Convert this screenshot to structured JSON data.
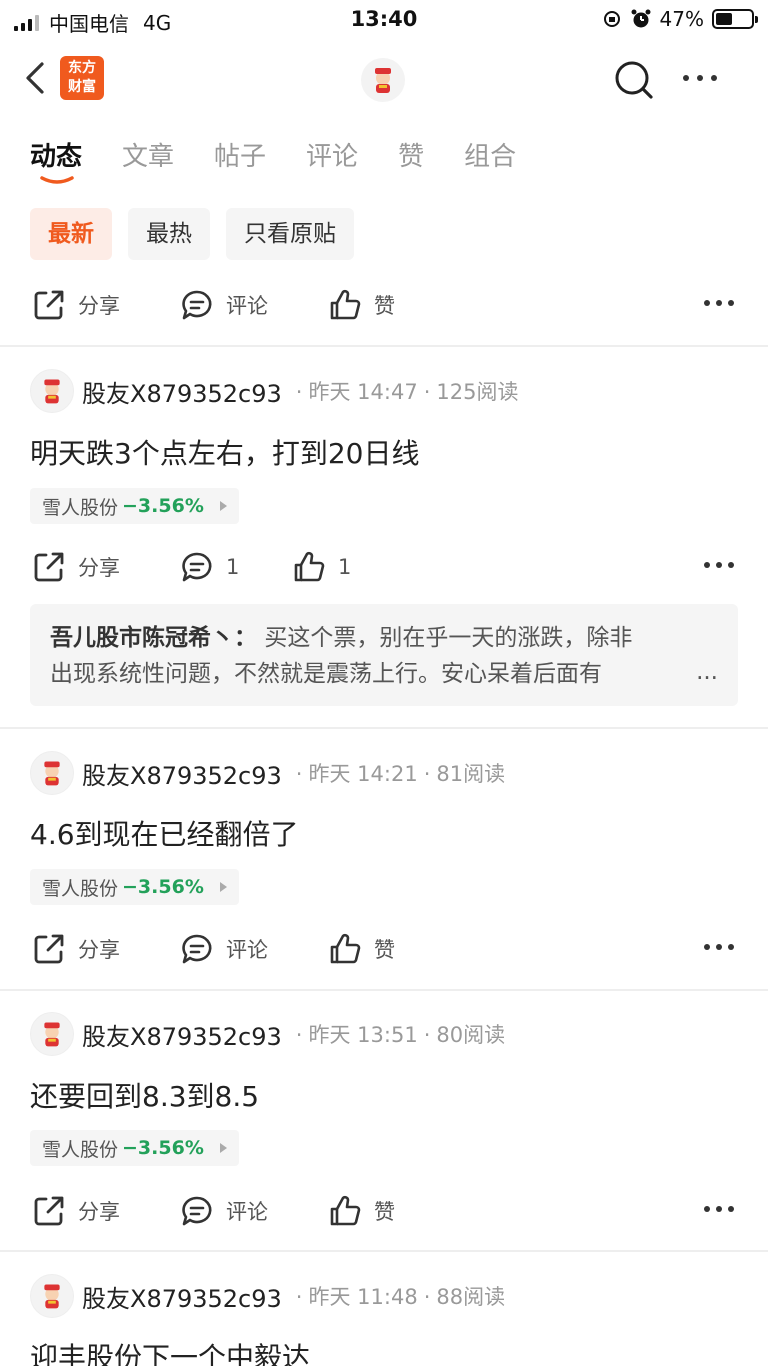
{
  "status_bar": {
    "carrier": "中国电信",
    "network": "4G",
    "time": "13:40",
    "battery": "47%",
    "battery_level": 0.47
  },
  "nav": {
    "logo_line1": "东方",
    "logo_line2": "财富"
  },
  "tabs": [
    {
      "label": "动态",
      "active": true
    },
    {
      "label": "文章"
    },
    {
      "label": "帖子"
    },
    {
      "label": "评论"
    },
    {
      "label": "赞"
    },
    {
      "label": "组合"
    }
  ],
  "filters": [
    "最新",
    "最热",
    "只看原贴"
  ],
  "top_actions": {
    "share": "分享",
    "comment": "评论",
    "like": "赞"
  },
  "posts": [
    {
      "author": "股友X879352c93",
      "time": "昨天 14:47",
      "reads": "125阅读",
      "content": "明天跌3个点左右，打到20日线",
      "stock": "雪人股份",
      "change": "−3.56%",
      "share": "分享",
      "comment": "1",
      "like": "1",
      "reply": {
        "author": "吾儿股市陈冠希丶：",
        "text_line1": "买这个票，别在乎一天的涨跌，除非",
        "text_line2": "出现系统性问题，不然就是震荡上行。安心呆着后面有",
        "ellipsis": "..."
      }
    },
    {
      "author": "股友X879352c93",
      "time": "昨天 14:21",
      "reads": "81阅读",
      "content": "4.6到现在已经翻倍了",
      "stock": "雪人股份",
      "change": "−3.56%",
      "share": "分享",
      "comment": "评论",
      "like": "赞"
    },
    {
      "author": "股友X879352c93",
      "time": "昨天 13:51",
      "reads": "80阅读",
      "content": "还要回到8.3到8.5",
      "stock": "雪人股份",
      "change": "−3.56%",
      "share": "分享",
      "comment": "评论",
      "like": "赞"
    },
    {
      "author": "股友X879352c93",
      "time": "昨天 11:48",
      "reads": "88阅读",
      "content": "迎丰股份下一个中毅达"
    }
  ]
}
